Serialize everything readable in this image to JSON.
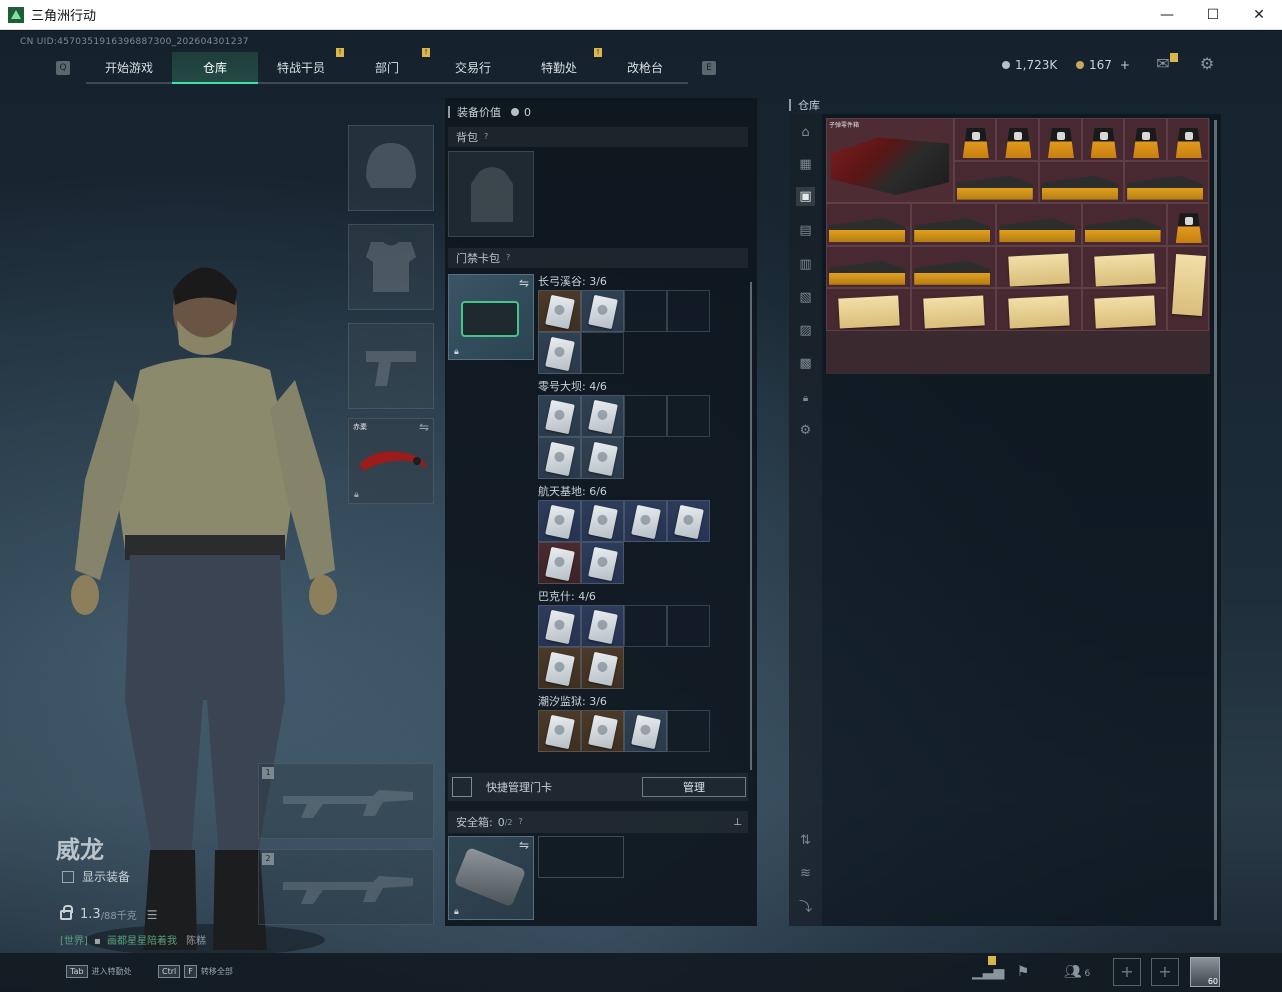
{
  "window": {
    "title": "三角洲行动"
  },
  "uid": "CN UID:4570351916396887300_202604301237",
  "nav": {
    "tabs": [
      {
        "label": "开始游戏",
        "badge": false
      },
      {
        "label": "仓库",
        "badge": false,
        "active": true
      },
      {
        "label": "特战干员",
        "badge": true
      },
      {
        "label": "部门",
        "badge": true
      },
      {
        "label": "交易行",
        "badge": false
      },
      {
        "label": "特勤处",
        "badge": true
      },
      {
        "label": "改枪台",
        "badge": false
      }
    ]
  },
  "currency": {
    "hafcoin": "1,723K",
    "premium": "167",
    "plus": "+"
  },
  "character": {
    "name": "威龙",
    "show_equipment": "显示装备",
    "weight": "1.3",
    "weight_max": "/88千克",
    "chat_channel": "[世界]",
    "chat_text": "画都星星陪着我",
    "chat_suffix": "陈糕"
  },
  "equip": {
    "melee_label": "赤橐"
  },
  "middle": {
    "equipment_value_label": "装备价值",
    "equipment_value": "0",
    "backpack_label": "背包",
    "keycard_label": "门禁卡包",
    "maps": [
      {
        "label": "长弓溪谷: 3/6"
      },
      {
        "label": "零号大坝: 4/6"
      },
      {
        "label": "航天基地: 6/6"
      },
      {
        "label": "巴克什: 4/6"
      },
      {
        "label": "潮汐监狱: 3/6"
      }
    ],
    "quick_manage_label": "快捷管理门卡",
    "manage_button": "管理",
    "safebox_label": "安全箱:",
    "safebox_value": "0",
    "safebox_cap": "/2"
  },
  "warehouse": {
    "label": "仓库",
    "big_item_tag": "子弹零件箱"
  },
  "bottom": {
    "tab_key": "Tab",
    "tab_label": "进入特勤处",
    "ctrl_key": "Ctrl",
    "f_key": "F",
    "ctrl_label": "转移全部",
    "friends_count": "6",
    "level": "60"
  },
  "colors": {
    "accent": "#42e0a6",
    "badge": "#d8b84a",
    "warehouse_cell": "#5a2832"
  },
  "icons": {
    "settings": "gear-icon",
    "mail": "mail-icon",
    "lock": "lock-icon"
  }
}
